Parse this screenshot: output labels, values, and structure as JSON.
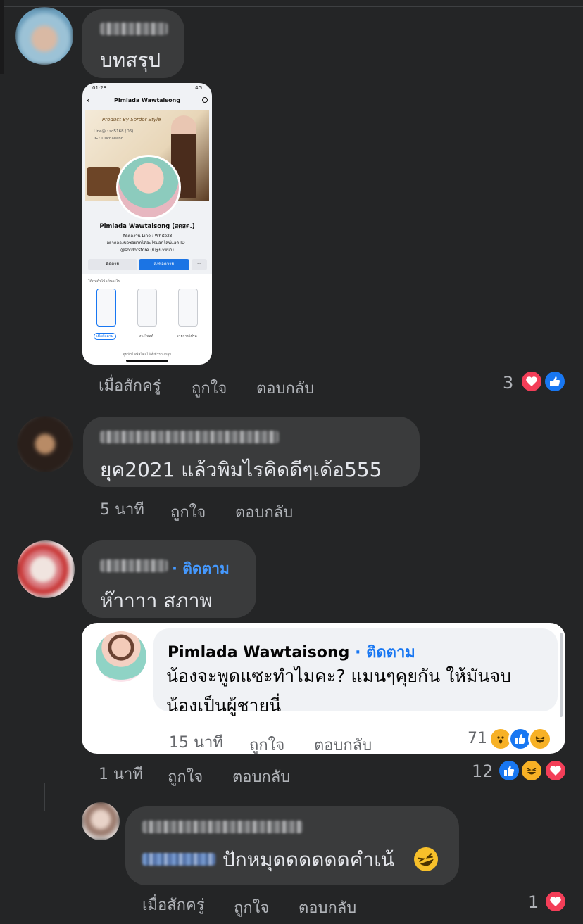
{
  "comments": [
    {
      "text": "บทสรุป",
      "actions": {
        "time": "เมื่อสักครู่",
        "like": "ถูกใจ",
        "reply": "ตอบกลับ"
      },
      "reaction_count": "3",
      "reactions": [
        "love",
        "like"
      ]
    },
    {
      "text": "ยุค2021 แล้วพิมไรคิดดีๆเด้อ555",
      "actions": {
        "time": "5 นาที",
        "like": "ถูกใจ",
        "reply": "ตอบกลับ"
      }
    },
    {
      "follow": "· ติดตาม",
      "text": "ห๊าาาา สภาพ",
      "actions": {
        "time": "1 นาที",
        "like": "ถูกใจ",
        "reply": "ตอบกลับ"
      },
      "reaction_count": "12",
      "reactions": [
        "like",
        "haha",
        "love"
      ]
    },
    {
      "text": "ปักหมุดดดดดดคำเน้",
      "actions": {
        "time": "เมื่อสักครู่",
        "like": "ถูกใจ",
        "reply": "ตอบกลับ"
      },
      "reaction_count": "1",
      "reactions": [
        "love"
      ]
    }
  ],
  "highlight_reply": {
    "name": "Pimlada Wawtaisong",
    "follow": "· ติดตาม",
    "line1": "น้องจะพูดแซะทำไมคะ? แมนๆคุยกัน ให้มันจบ",
    "line2": "น้องเป็นผู้ชายนี่",
    "actions": {
      "time": "15 นาที",
      "like": "ถูกใจ",
      "reply": "ตอบกลับ"
    },
    "reaction_count": "71",
    "reactions": [
      "wow",
      "like",
      "haha"
    ]
  },
  "attached_screenshot": {
    "status_time": "01:28",
    "status_right": "4G",
    "page_title": "Pimlada Wawtaisong",
    "cover_brand": "Product By Sordor Style",
    "cover_line1": "Line@ : sd5168 (D6)",
    "cover_line2": "IG : Duchailand",
    "profile_name": "Pimlada Wawtaisong (สดสด.)",
    "bio1": "ติดต่องาน Line : Whitez8",
    "bio2": "อยากลองบวชอยากได้อะไรบอกไลน์แอด ID :",
    "bio3": "@sordorstore (มี@นำหน้า)",
    "btn_follow": "ติดตาม",
    "btn_message": "ส่งข้อความ",
    "btn_more": "···",
    "sheet_title": "ให้คนทั่วไป เห็นอะไร",
    "sheet_opt1": "เมื่อตัดตาม",
    "sheet_opt2": "ทางโพสต์",
    "sheet_opt3": "รายการโปรด",
    "sheet_footer": "ดูหน้าไลฟ์สไตล์ได้ที่เข้าร่วมกลุ่ม"
  },
  "colors": {
    "background": "#242526",
    "bubble": "#3a3b3c",
    "link": "#4599ff",
    "like": "#1877f2",
    "love": "#f33e58",
    "haha": "#f7b125"
  }
}
